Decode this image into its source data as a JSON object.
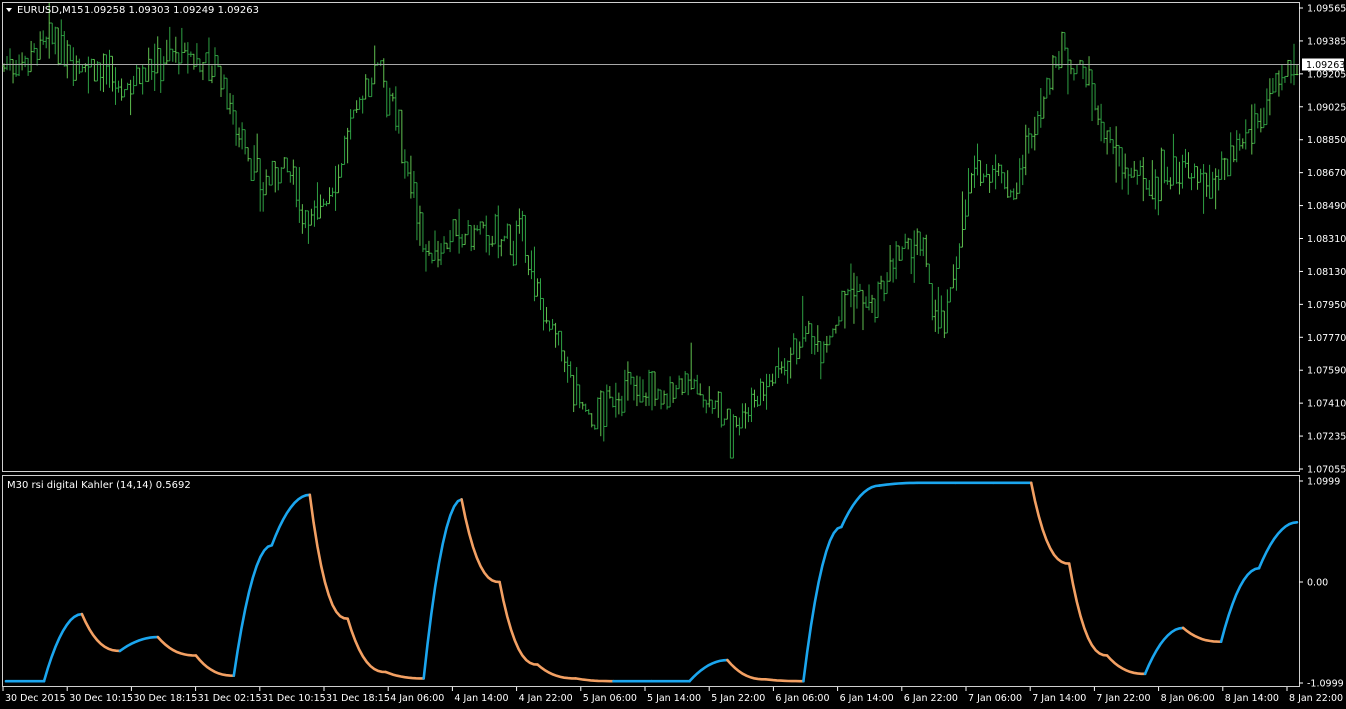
{
  "main_chart": {
    "symbol_label": "EURUSD,M15",
    "ohlc_label": "1.09258 1.09303 1.09249 1.09263",
    "current_price_label": "1.09263",
    "current_price": 1.09263,
    "price_axis_labels": [
      "1.09565",
      "1.09385",
      "1.09205",
      "1.09025",
      "1.08850",
      "1.08670",
      "1.08490",
      "1.08310",
      "1.08130",
      "1.07950",
      "1.07770",
      "1.07590",
      "1.07410",
      "1.07235",
      "1.07055"
    ],
    "colors": {
      "bars": "#2ea043",
      "bars_light": "#5fbf4f",
      "background": "#000000",
      "axis": "#ffffff",
      "price_line": "#b4b4b4"
    }
  },
  "indicator": {
    "label": "M30 rsi digital Kahler (14,14) 0.5692",
    "axis_labels": [
      "1.0999",
      "0.00",
      "-1.0999"
    ],
    "colors": {
      "up": "#1ba6ef",
      "down": "#f3a063"
    }
  },
  "time_axis_labels": [
    "30 Dec 2015",
    "30 Dec 10:15",
    "30 Dec 18:15",
    "31 Dec 02:15",
    "31 Dec 10:15",
    "31 Dec 18:15",
    "4 Jan 06:00",
    "4 Jan 14:00",
    "4 Jan 22:00",
    "5 Jan 06:00",
    "5 Jan 14:00",
    "5 Jan 22:00",
    "6 Jan 06:00",
    "6 Jan 14:00",
    "6 Jan 22:00",
    "7 Jan 06:00",
    "7 Jan 14:00",
    "7 Jan 22:00",
    "8 Jan 06:00",
    "8 Jan 14:00",
    "8 Jan 22:00"
  ],
  "chart_data": {
    "type": "line",
    "title": "EURUSD,M15",
    "x": [
      "30 Dec 2015",
      "30 Dec 10:15",
      "30 Dec 18:15",
      "31 Dec 02:15",
      "31 Dec 10:15",
      "31 Dec 18:15",
      "4 Jan 06:00",
      "4 Jan 14:00",
      "4 Jan 22:00",
      "5 Jan 06:00",
      "5 Jan 14:00",
      "5 Jan 22:00",
      "6 Jan 06:00",
      "6 Jan 14:00",
      "6 Jan 22:00",
      "7 Jan 06:00",
      "7 Jan 14:00",
      "7 Jan 22:00",
      "8 Jan 06:00",
      "8 Jan 14:00",
      "8 Jan 22:00"
    ],
    "ylim": [
      1.07055,
      1.09565
    ],
    "price_series": [
      1.0925,
      1.093,
      1.0938,
      1.093,
      1.0922,
      1.091,
      1.0925,
      1.0932,
      1.093,
      1.0926,
      1.089,
      1.086,
      1.087,
      1.084,
      1.086,
      1.09,
      1.0932,
      1.088,
      1.082,
      1.083,
      1.0835,
      1.083,
      1.0832,
      1.079,
      1.076,
      1.073,
      1.0745,
      1.0752,
      1.0742,
      1.0758,
      1.074,
      1.073,
      1.0745,
      1.076,
      1.078,
      1.0775,
      1.0805,
      1.079,
      1.082,
      1.0825,
      1.078,
      1.086,
      1.087,
      1.0855,
      1.09,
      1.0935,
      1.092,
      1.088,
      1.0865,
      1.086,
      1.087,
      1.086,
      1.0865,
      1.089,
      1.091,
      1.0925
    ],
    "indicator_series": {
      "name": "M30 rsi digital Kahler (14,14)",
      "ylim": [
        -1.0999,
        1.0999
      ],
      "points": [
        [
          0,
          -1.08
        ],
        [
          1,
          -1.08
        ],
        [
          2,
          -0.35
        ],
        [
          3,
          -0.75
        ],
        [
          4,
          -0.6
        ],
        [
          5,
          -0.8
        ],
        [
          6,
          -1.02
        ],
        [
          7,
          0.4
        ],
        [
          8,
          0.95
        ],
        [
          9,
          -0.4
        ],
        [
          10,
          -0.98
        ],
        [
          11,
          -1.05
        ],
        [
          12,
          0.9
        ],
        [
          13,
          0.0
        ],
        [
          14,
          -0.9
        ],
        [
          15,
          -1.05
        ],
        [
          16,
          -1.08
        ],
        [
          17,
          -1.08
        ],
        [
          18,
          -1.08
        ],
        [
          19,
          -0.85
        ],
        [
          20,
          -1.06
        ],
        [
          21,
          -1.08
        ],
        [
          22,
          0.6
        ],
        [
          23,
          1.05
        ],
        [
          24,
          1.08
        ],
        [
          25,
          1.08
        ],
        [
          26,
          1.08
        ],
        [
          27,
          1.08
        ],
        [
          28,
          0.2
        ],
        [
          29,
          -0.8
        ],
        [
          30,
          -1.0
        ],
        [
          31,
          -0.5
        ],
        [
          32,
          -0.65
        ],
        [
          33,
          0.15
        ],
        [
          34,
          0.65
        ]
      ]
    }
  }
}
